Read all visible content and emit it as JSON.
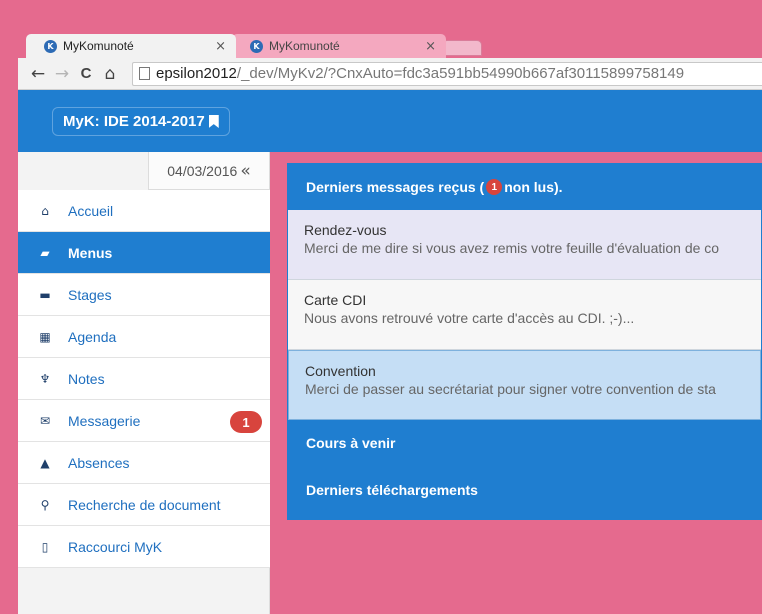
{
  "browser": {
    "tabs": [
      {
        "title": "MyKomunoté",
        "close": "×",
        "active": true
      },
      {
        "title": "MyKomunoté",
        "close": "×",
        "active": false
      }
    ],
    "favicon_letter": "K",
    "nav": {
      "back": "←",
      "forward": "→",
      "reload": "C",
      "home": "⌂"
    },
    "url_host": "epsilon2012",
    "url_path": "/_dev/MyKv2/?CnxAuto=fdc3a591bb54990b667af30115899758149"
  },
  "header": {
    "brand": "MyK: IDE 2014-2017"
  },
  "sidebar": {
    "date": "04/03/2016",
    "collapse": "«",
    "items": [
      {
        "label": "Accueil",
        "icon": "home-icon",
        "glyph": "⌂"
      },
      {
        "label": "Menus",
        "icon": "book-icon",
        "glyph": "▰"
      },
      {
        "label": "Stages",
        "icon": "folder-icon",
        "glyph": "▬"
      },
      {
        "label": "Agenda",
        "icon": "calendar-icon",
        "glyph": "▦"
      },
      {
        "label": "Notes",
        "icon": "trophy-icon",
        "glyph": "♆"
      },
      {
        "label": "Messagerie",
        "icon": "envelope-icon",
        "glyph": "✉",
        "badge": "1"
      },
      {
        "label": "Absences",
        "icon": "bell-icon",
        "glyph": "▲"
      },
      {
        "label": "Recherche de document",
        "icon": "search-icon",
        "glyph": "⚲"
      },
      {
        "label": "Raccourci MyK",
        "icon": "mobile-icon",
        "glyph": "▯"
      }
    ]
  },
  "main": {
    "messages_header_prefix": "Derniers messages reçus (",
    "messages_unread_count": "1",
    "messages_header_suffix": " non lus).",
    "messages": [
      {
        "title": "Rendez-vous",
        "body": "Merci de me dire si vous avez remis votre feuille d'évaluation de co"
      },
      {
        "title": "Carte CDI",
        "body": "Nous avons retrouvé votre carte d'accès au CDI. ;-)..."
      },
      {
        "title": "Convention",
        "body": "Merci de passer au secrétariat pour signer votre convention de sta"
      }
    ],
    "courses_header": "Cours à venir",
    "downloads_header": "Derniers téléchargements"
  },
  "colors": {
    "accent": "#1f7ed0",
    "badge": "#d8443d",
    "window_frame": "#e56a8e"
  }
}
